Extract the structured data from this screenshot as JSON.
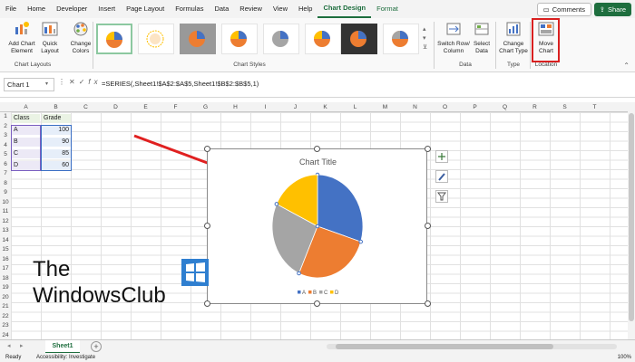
{
  "menu": {
    "tabs": [
      "File",
      "Home",
      "Developer",
      "Insert",
      "Page Layout",
      "Formulas",
      "Data",
      "Review",
      "View",
      "Help",
      "Chart Design",
      "Format"
    ],
    "active_tab": "Chart Design",
    "comments_label": "Comments",
    "share_label": "Share"
  },
  "ribbon": {
    "add_chart_element": "Add Chart Element",
    "quick_layout": "Quick Layout",
    "change_colors": "Change Colors",
    "chart_layouts_label": "Chart Layouts",
    "chart_styles_label": "Chart Styles",
    "switch_row_column": "Switch Row/ Column",
    "select_data": "Select Data",
    "data_label": "Data",
    "change_chart_type": "Change Chart Type",
    "type_label": "Type",
    "move_chart": "Move Chart",
    "location_label": "Location"
  },
  "formula_bar": {
    "name_box": "Chart 1",
    "formula": "=SERIES(,Sheet1!$A$2:$A$5,Sheet1!$B$2:$B$5,1)"
  },
  "columns": [
    "A",
    "B",
    "C",
    "D",
    "E",
    "F",
    "G",
    "H",
    "I",
    "J",
    "K",
    "L",
    "M",
    "N",
    "O",
    "P",
    "Q",
    "R",
    "S",
    "T"
  ],
  "rows": [
    "1",
    "2",
    "3",
    "4",
    "5",
    "6",
    "7",
    "8",
    "9",
    "10",
    "11",
    "12",
    "13",
    "14",
    "15",
    "16",
    "17",
    "18",
    "19",
    "20",
    "21",
    "22",
    "23",
    "24"
  ],
  "table": {
    "header": [
      "Class",
      "Grade"
    ],
    "rows": [
      {
        "class": "A",
        "grade": "100"
      },
      {
        "class": "B",
        "grade": "90"
      },
      {
        "class": "C",
        "grade": "85"
      },
      {
        "class": "D",
        "grade": "60"
      }
    ]
  },
  "chart_data": {
    "type": "pie",
    "title": "Chart Title",
    "categories": [
      "A",
      "B",
      "C",
      "D"
    ],
    "values": [
      100,
      90,
      85,
      60
    ],
    "colors": [
      "#4472c4",
      "#ed7d31",
      "#a5a5a5",
      "#ffc000"
    ],
    "legend": "bottom"
  },
  "sheet": {
    "tab": "Sheet1",
    "add_sheet": "+"
  },
  "status": {
    "ready": "Ready",
    "accessibility": "Accessibility: Investigate",
    "zoom": "100%"
  },
  "watermark": {
    "line1": "The",
    "line2": "WindowsClub"
  },
  "colors": {
    "accent": "#1e6e3e",
    "highlight": "#d92020",
    "arrow": "#e02020"
  }
}
